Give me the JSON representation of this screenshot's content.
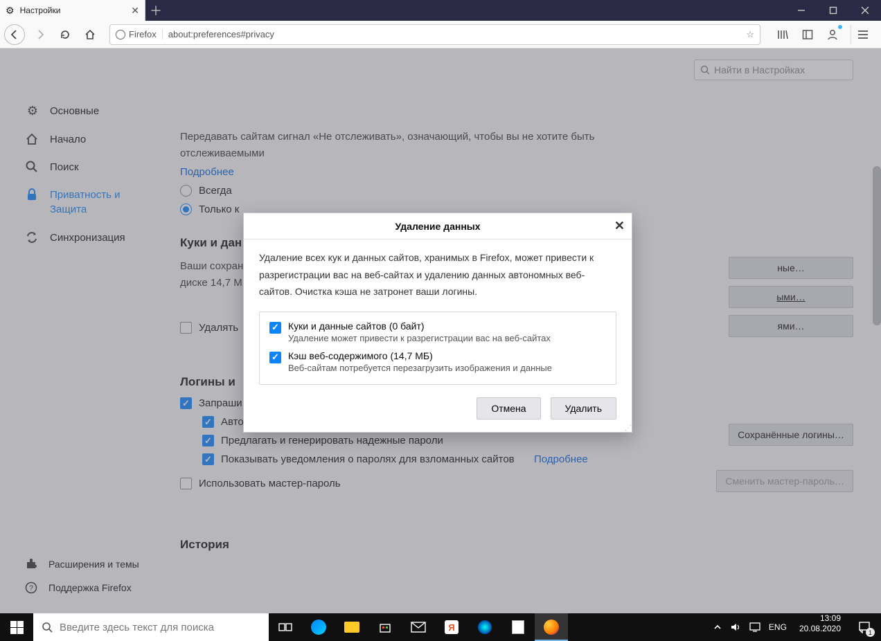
{
  "window": {
    "tab_title": "Настройки",
    "url_identity": "Firefox",
    "url": "about:preferences#privacy"
  },
  "search": {
    "placeholder": "Найти в Настройках"
  },
  "sidebar": {
    "items": [
      {
        "label": "Основные"
      },
      {
        "label": "Начало"
      },
      {
        "label": "Поиск"
      },
      {
        "label": "Приватность и Защита"
      },
      {
        "label": "Синхронизация"
      }
    ],
    "bottom": [
      {
        "label": "Расширения и темы"
      },
      {
        "label": "Поддержка Firefox"
      }
    ]
  },
  "tracking": {
    "text": "Передавать сайтам сигнал «Не отслеживать», означающий, чтобы вы не хотите быть отслеживаемыми",
    "learn_more": "Подробнее",
    "opt_always": "Всегда",
    "opt_only_prefix": "Только к"
  },
  "cookies": {
    "heading_partial": "Куки и дан",
    "stored_line1_partial": "Ваши сохран",
    "stored_line2_partial": "диске 14,7 М",
    "btn_data_label_partial": "ные…",
    "btn_manage_label_partial": "ыми…",
    "btn_exceptions_label_partial": "ями…",
    "delete_on_close_partial": "Удалять"
  },
  "logins": {
    "heading_partial": "Логины и",
    "ask_save_partial": "Запраши",
    "autofill": "Автозаполнять логины и пароли",
    "suggest": "Предлагать и генерировать надежные пароли",
    "breach": "Показывать уведомления о паролях для взломанных сайтов",
    "breach_more": "Подробнее",
    "use_master": "Использовать мастер-пароль",
    "saved_logins_btn": "Сохранённые логины…",
    "change_master_btn": "Сменить мастер-пароль…"
  },
  "history": {
    "heading": "История"
  },
  "modal": {
    "title": "Удаление данных",
    "body": "Удаление всех кук и данных сайтов, хранимых в Firefox, может привести к разрегистрации вас на веб-сайтах и удалению данных автономных веб-сайтов. Очистка кэша не затронет ваши логины.",
    "opt1_label": "Куки и данные сайтов (0 байт)",
    "opt1_sub": "Удаление может привести к разрегистрации вас на веб-сайтах",
    "opt2_label": "Кэш веб-содержимого (14,7 МБ)",
    "opt2_sub": "Веб-сайтам потребуется перезагрузить изображения и данные",
    "cancel": "Отмена",
    "clear": "Удалить"
  },
  "taskbar": {
    "search_placeholder": "Введите здесь текст для поиска",
    "lang": "ENG",
    "time": "13:09",
    "date": "20.08.2020",
    "notif_count": "1"
  }
}
